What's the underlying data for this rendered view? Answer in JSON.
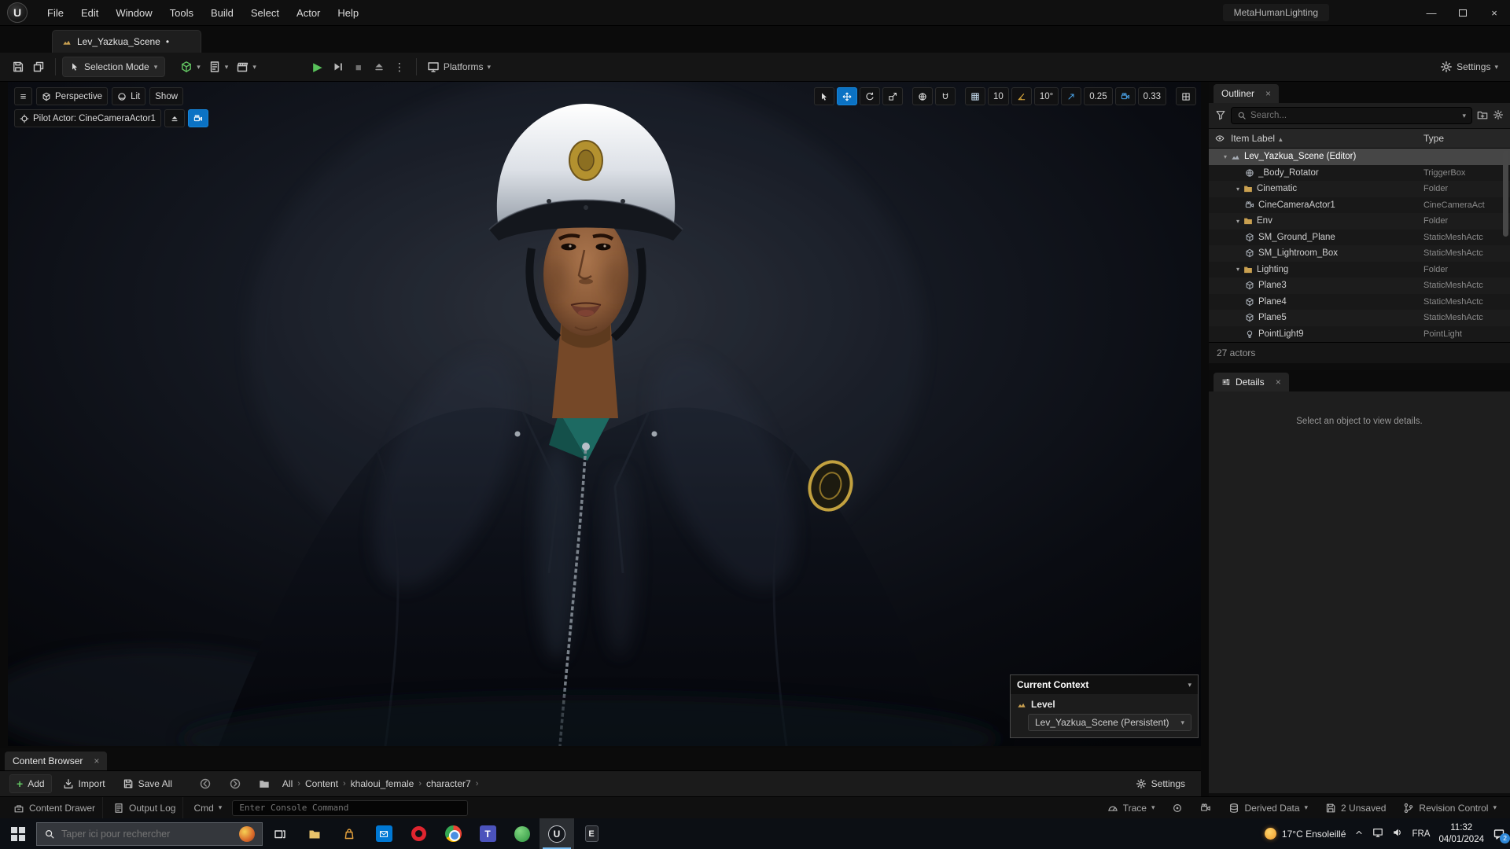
{
  "app": {
    "logo": "U",
    "window_title": "MetaHumanLighting",
    "menu": [
      "File",
      "Edit",
      "Window",
      "Tools",
      "Build",
      "Select",
      "Actor",
      "Help"
    ],
    "tab_label": "Lev_Yazkua_Scene",
    "tab_unsaved": "•"
  },
  "toolbar": {
    "selection_mode_label": "Selection Mode",
    "platforms_label": "Platforms",
    "settings_label": "Settings"
  },
  "viewport": {
    "buttons": {
      "perspective": "Perspective",
      "lit": "Lit",
      "show": "Show"
    },
    "pilot_label": "Pilot Actor: CineCameraActor1",
    "snap": {
      "grid": "10",
      "rotation": "10°",
      "scale": "0.25",
      "camera_speed": "0.33"
    },
    "context_panel": {
      "title": "Current Context",
      "level_label": "Level",
      "level_value": "Lev_Yazkua_Scene (Persistent)"
    }
  },
  "outliner": {
    "tab_title": "Outliner",
    "search_placeholder": "Search...",
    "columns": {
      "item": "Item Label",
      "type": "Type"
    },
    "rows": [
      {
        "icon": "level-icon",
        "label": "Lev_Yazkua_Scene (Editor)",
        "type": ""
      },
      {
        "icon": "trigger-icon",
        "label": "_Body_Rotator",
        "type": "TriggerBox"
      },
      {
        "icon": "folder-icon",
        "label": "Cinematic",
        "type": "Folder"
      },
      {
        "icon": "cine-camera-icon",
        "label": "CineCameraActor1",
        "type": "CineCameraAct"
      },
      {
        "icon": "folder-icon",
        "label": "Env",
        "type": "Folder"
      },
      {
        "icon": "static-mesh-icon",
        "label": "SM_Ground_Plane",
        "type": "StaticMeshActc"
      },
      {
        "icon": "static-mesh-icon",
        "label": "SM_Lightroom_Box",
        "type": "StaticMeshActc"
      },
      {
        "icon": "folder-icon",
        "label": "Lighting",
        "type": "Folder"
      },
      {
        "icon": "static-mesh-icon",
        "label": "Plane3",
        "type": "StaticMeshActc"
      },
      {
        "icon": "static-mesh-icon",
        "label": "Plane4",
        "type": "StaticMeshActc"
      },
      {
        "icon": "static-mesh-icon",
        "label": "Plane5",
        "type": "StaticMeshActc"
      },
      {
        "icon": "point-light-icon",
        "label": "PointLight9",
        "type": "PointLight"
      }
    ],
    "footer": "27 actors"
  },
  "details": {
    "tab_title": "Details",
    "empty_message": "Select an object to view details."
  },
  "content_browser": {
    "tab_title": "Content Browser",
    "add_label": "Add",
    "import_label": "Import",
    "save_all_label": "Save All",
    "breadcrumbs": [
      "All",
      "Content",
      "khaloui_female",
      "character7"
    ],
    "settings_label": "Settings"
  },
  "status_bar": {
    "content_drawer": "Content Drawer",
    "output_log": "Output Log",
    "cmd": "Cmd",
    "console_placeholder": "Enter Console Command",
    "trace": "Trace",
    "derived_data": "Derived Data",
    "unsaved": "2 Unsaved",
    "revision_control": "Revision Control"
  },
  "taskbar": {
    "search_placeholder": "Taper ici pour rechercher",
    "weather": "17°C Ensoleillé",
    "language": "FRA",
    "time": "11:32",
    "date": "04/01/2024",
    "notification_count": "2"
  },
  "icons": {
    "chevron_down": "▾",
    "close": "×",
    "menu": "≡",
    "sort_asc": "▲",
    "expanded": "▾",
    "crumb_sep": "›",
    "kebab": "⋮",
    "play": "▶",
    "stop": "■"
  },
  "colors": {
    "accent_blue": "#0b72c4",
    "play_green": "#58c05a",
    "folder_amber": "#c9a050",
    "selection_grey": "#464646"
  }
}
